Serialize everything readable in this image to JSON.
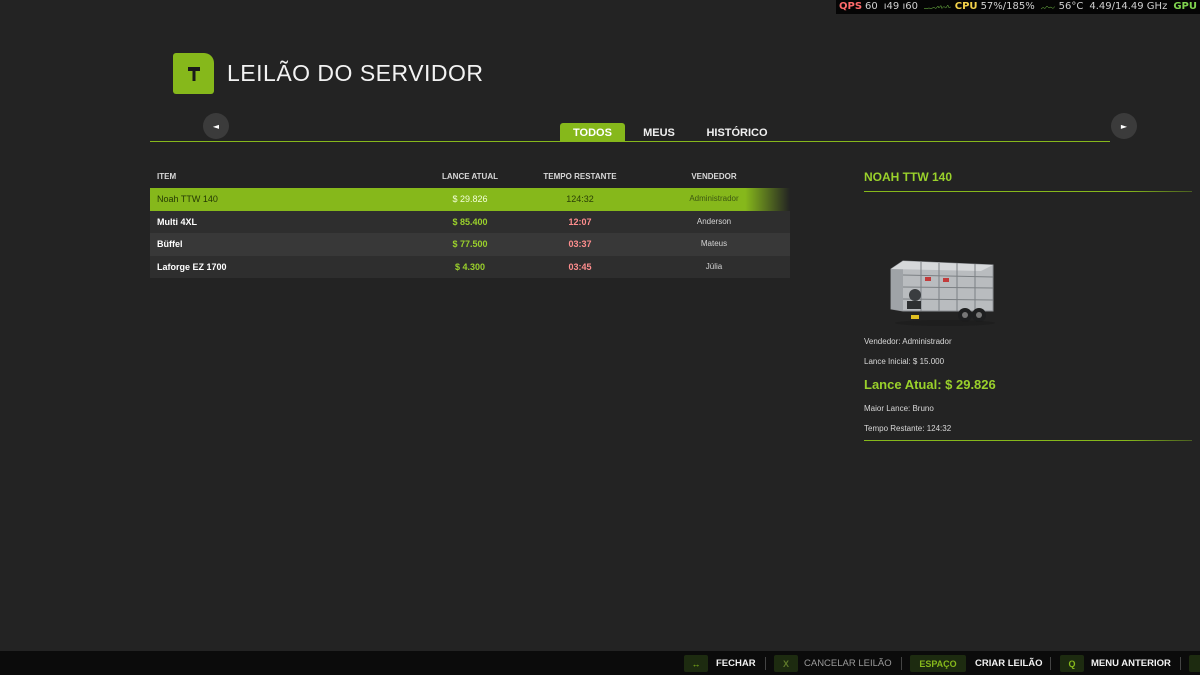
{
  "perf": {
    "fps_label": "QPS",
    "fps_value": "60",
    "frame_value": "ı49 ı60",
    "cpu_label": "CPU",
    "cpu_value": "57%/185%",
    "temp_value": "56°C",
    "mem_value": "4.49/14.49 GHz",
    "gpu_label": "GPU"
  },
  "header": {
    "title": "LEILÃO DO SERVIDOR",
    "logo_icon": "gavel-icon"
  },
  "nav": {
    "prev_glyph": "◄",
    "next_glyph": "►"
  },
  "tabs": [
    {
      "label": "TODOS",
      "active": true
    },
    {
      "label": "MEUS",
      "active": false
    },
    {
      "label": "HISTÓRICO",
      "active": false
    }
  ],
  "table": {
    "headers": {
      "item": "ITEM",
      "bid": "LANCE ATUAL",
      "time": "TEMPO RESTANTE",
      "seller": "VENDEDOR"
    },
    "rows": [
      {
        "item": "Noah TTW 140",
        "bid": "$ 29.826",
        "time": "124:32",
        "seller": "Administrador"
      },
      {
        "item": "Multi 4XL",
        "bid": "$ 85.400",
        "time": "12:07",
        "seller": "Anderson"
      },
      {
        "item": "Büffel",
        "bid": "$ 77.500",
        "time": "03:37",
        "seller": "Mateus"
      },
      {
        "item": "Laforge EZ 1700",
        "bid": "$ 4.300",
        "time": "03:45",
        "seller": "Júlia"
      }
    ]
  },
  "detail": {
    "title": "NOAH TTW 140",
    "seller": "Vendedor: Administrador",
    "initial_bid": "Lance Inicial: $ 15.000",
    "current_bid": "Lance Atual: $ 29.826",
    "highest_bidder": "Maior Lance: Bruno",
    "time_left": "Tempo Restante: 124:32"
  },
  "footer": {
    "actions": [
      {
        "key": "↔",
        "label": "FECHAR",
        "enabled": true
      },
      {
        "key": "X",
        "label": "CANCELAR LEILÃO",
        "enabled": false
      },
      {
        "key": "ESPAÇO",
        "label": "CRIAR LEILÃO",
        "enabled": true
      },
      {
        "key": "Q",
        "label": "MENU ANTERIOR",
        "enabled": true
      }
    ]
  },
  "colors": {
    "accent": "#86b81b",
    "accent_text": "#9ad12b",
    "time_red": "#ff8e8e",
    "background": "#232323"
  }
}
